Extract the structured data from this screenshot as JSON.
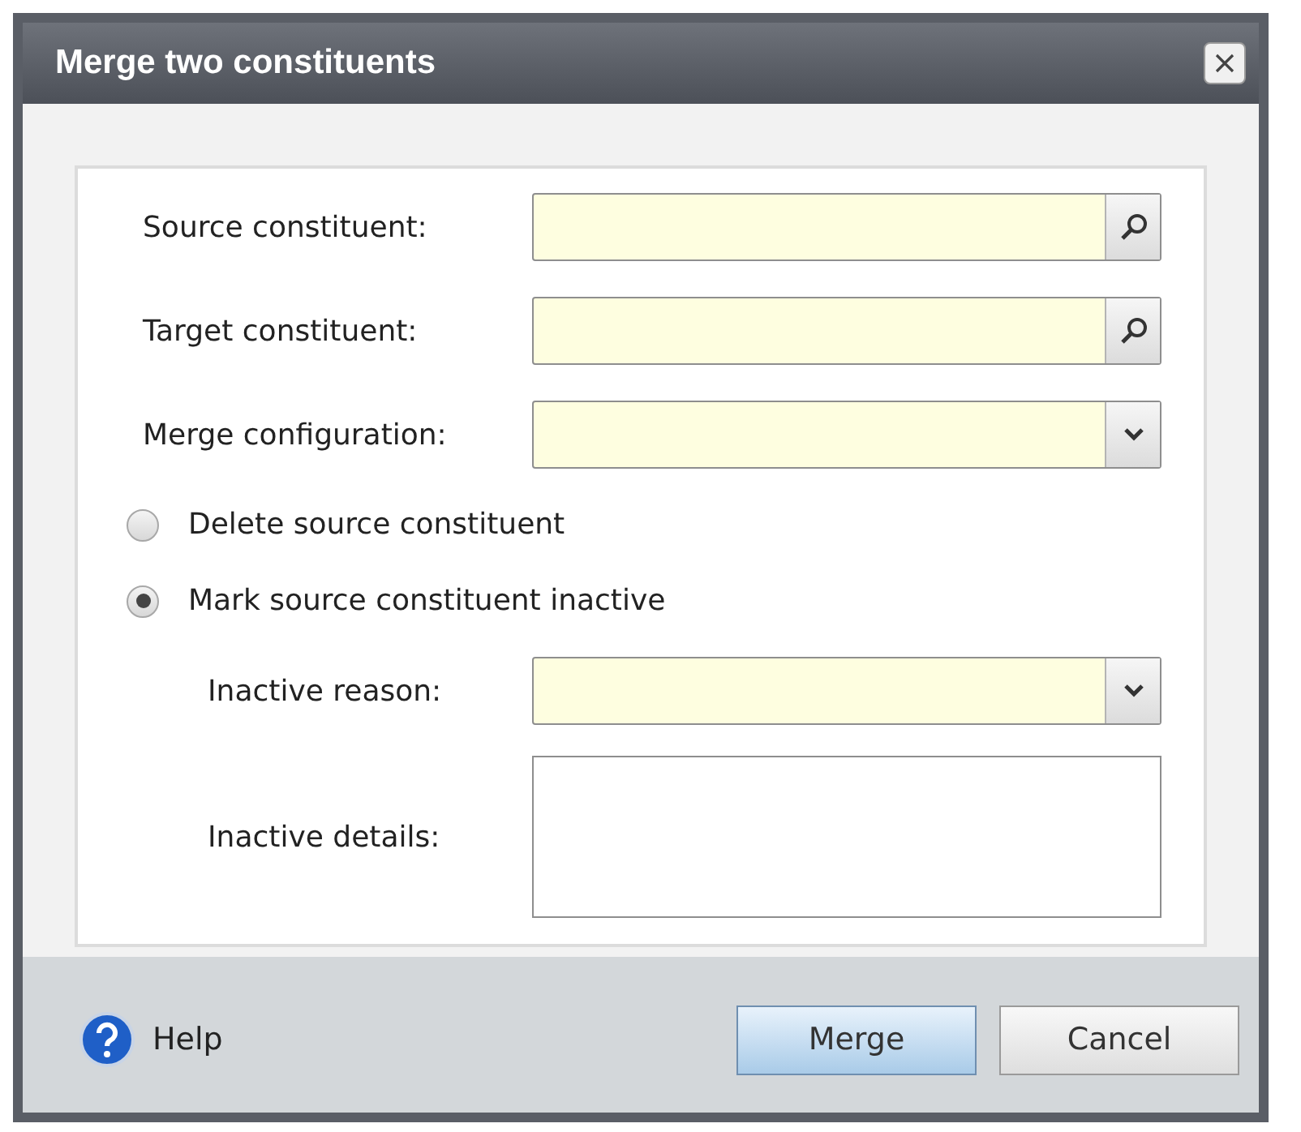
{
  "window": {
    "title": "Merge two constituents"
  },
  "fields": [
    {
      "kind": "lookup",
      "label": "Source constituent:",
      "indented": false
    },
    {
      "kind": "lookup",
      "label": "Target constituent:",
      "indented": false
    },
    {
      "kind": "dropdown",
      "label": "Merge configuration:",
      "indented": false
    }
  ],
  "options": [
    {
      "label": "Delete source constituent",
      "selected": false
    },
    {
      "label": "Mark source constituent inactive",
      "selected": true
    }
  ],
  "sub_fields": [
    {
      "kind": "dropdown",
      "label": "Inactive reason:",
      "indented": true
    },
    {
      "kind": "textarea",
      "label": "Inactive details:",
      "indented": true
    }
  ],
  "help": {
    "label": "Help"
  },
  "buttons": [
    {
      "label": "Merge",
      "default": true
    },
    {
      "label": "Cancel",
      "default": false
    }
  ]
}
